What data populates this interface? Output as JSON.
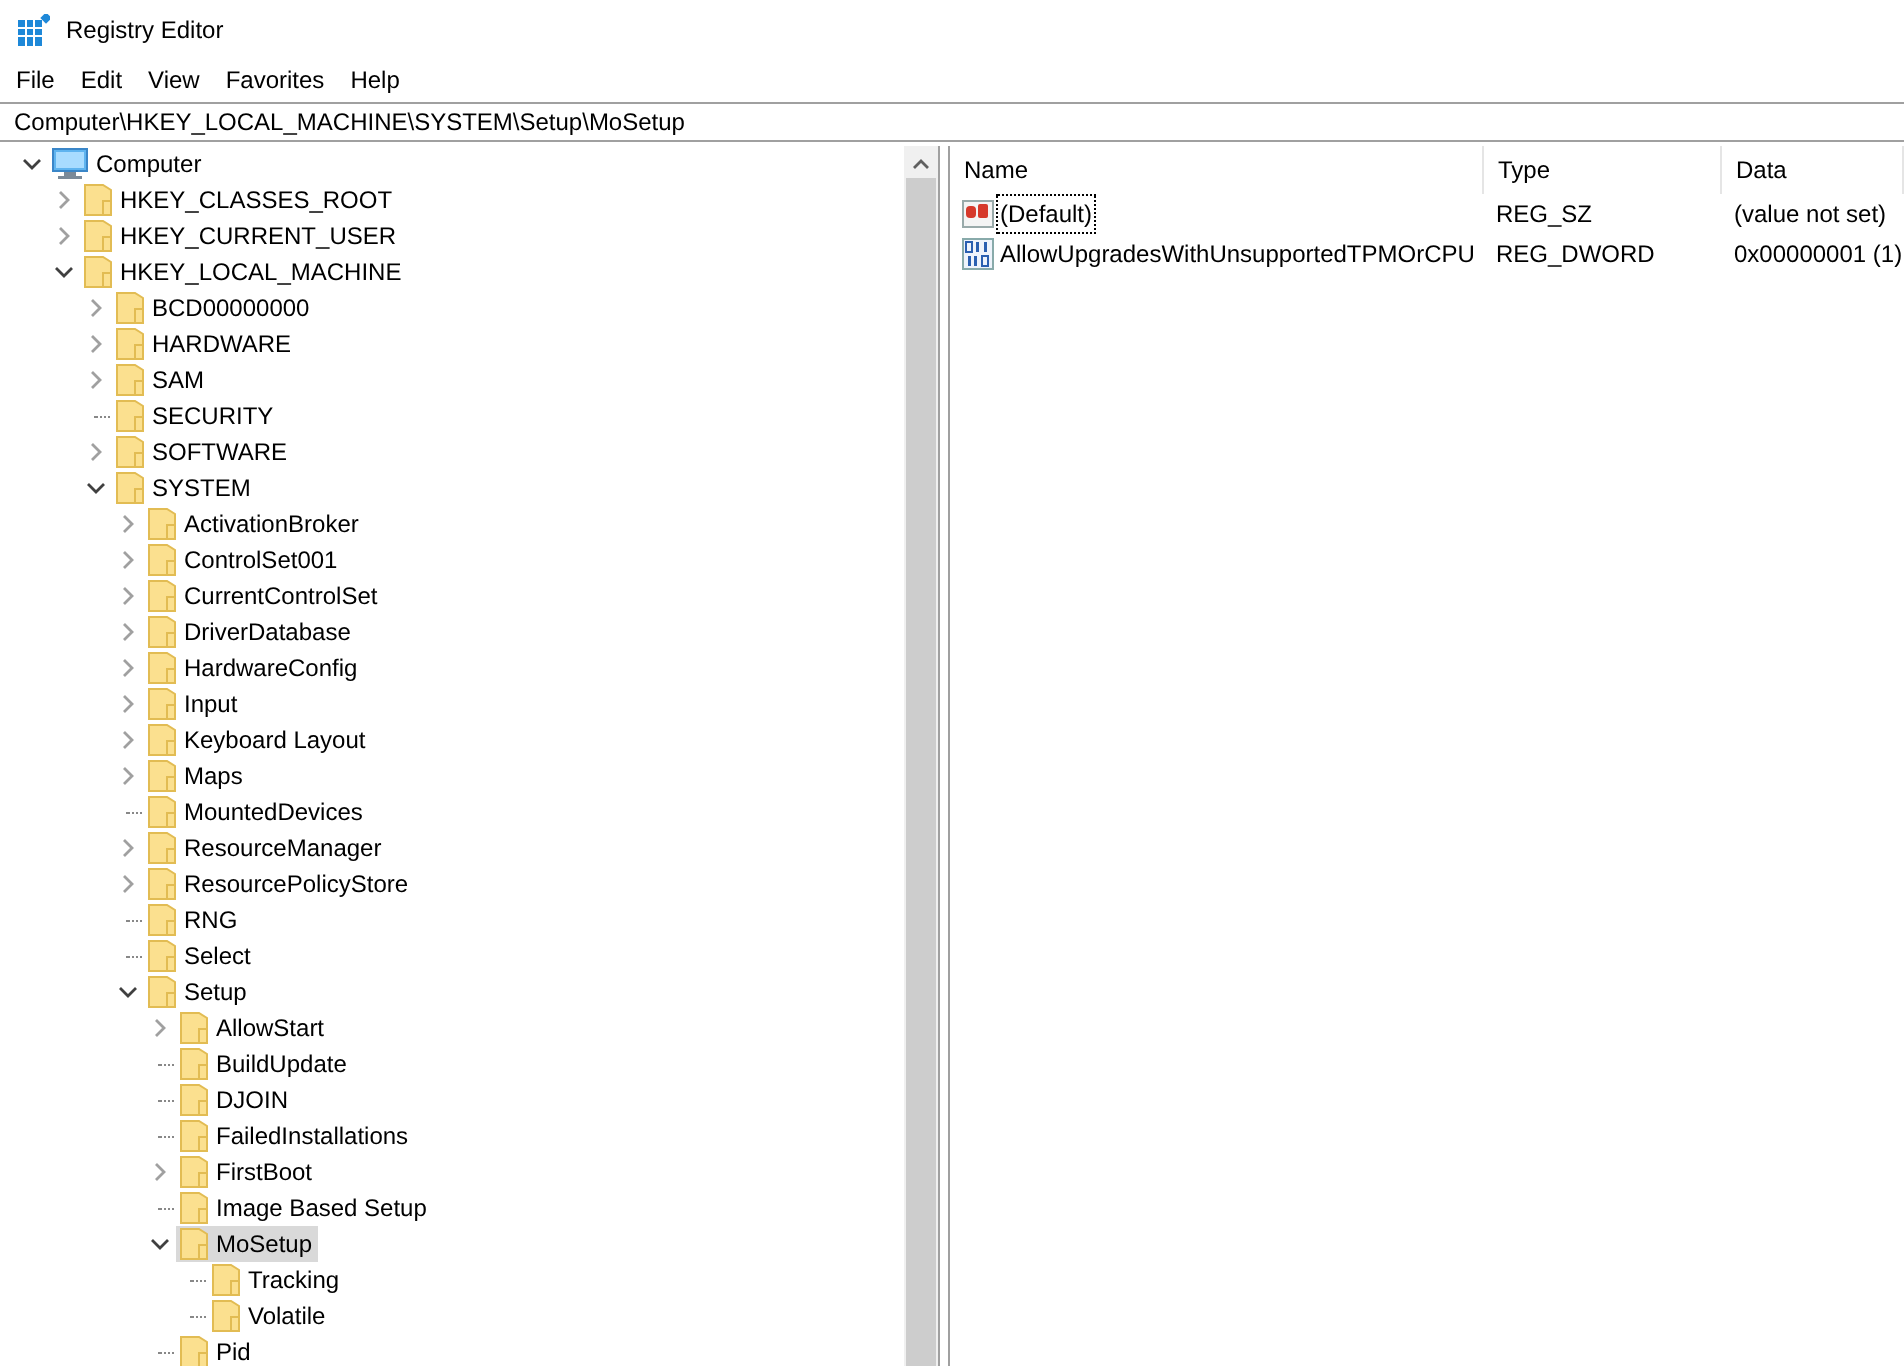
{
  "window": {
    "title": "Registry Editor"
  },
  "menu": [
    "File",
    "Edit",
    "View",
    "Favorites",
    "Help"
  ],
  "address": "Computer\\HKEY_LOCAL_MACHINE\\SYSTEM\\Setup\\MoSetup",
  "tree": [
    {
      "label": "Computer",
      "kind": "computer",
      "has_children": true,
      "expanded": true,
      "selected": false,
      "children": [
        {
          "label": "HKEY_CLASSES_ROOT",
          "kind": "folder",
          "has_children": true,
          "expanded": false,
          "selected": false
        },
        {
          "label": "HKEY_CURRENT_USER",
          "kind": "folder",
          "has_children": true,
          "expanded": false,
          "selected": false
        },
        {
          "label": "HKEY_LOCAL_MACHINE",
          "kind": "folder",
          "has_children": true,
          "expanded": true,
          "selected": false,
          "children": [
            {
              "label": "BCD00000000",
              "kind": "folder",
              "has_children": true,
              "expanded": false,
              "selected": false
            },
            {
              "label": "HARDWARE",
              "kind": "folder",
              "has_children": true,
              "expanded": false,
              "selected": false
            },
            {
              "label": "SAM",
              "kind": "folder",
              "has_children": true,
              "expanded": false,
              "selected": false
            },
            {
              "label": "SECURITY",
              "kind": "folder",
              "has_children": false,
              "expanded": false,
              "selected": false
            },
            {
              "label": "SOFTWARE",
              "kind": "folder",
              "has_children": true,
              "expanded": false,
              "selected": false
            },
            {
              "label": "SYSTEM",
              "kind": "folder",
              "has_children": true,
              "expanded": true,
              "selected": false,
              "children": [
                {
                  "label": "ActivationBroker",
                  "kind": "folder",
                  "has_children": true,
                  "expanded": false,
                  "selected": false
                },
                {
                  "label": "ControlSet001",
                  "kind": "folder",
                  "has_children": true,
                  "expanded": false,
                  "selected": false
                },
                {
                  "label": "CurrentControlSet",
                  "kind": "folder",
                  "has_children": true,
                  "expanded": false,
                  "selected": false
                },
                {
                  "label": "DriverDatabase",
                  "kind": "folder",
                  "has_children": true,
                  "expanded": false,
                  "selected": false
                },
                {
                  "label": "HardwareConfig",
                  "kind": "folder",
                  "has_children": true,
                  "expanded": false,
                  "selected": false
                },
                {
                  "label": "Input",
                  "kind": "folder",
                  "has_children": true,
                  "expanded": false,
                  "selected": false
                },
                {
                  "label": "Keyboard Layout",
                  "kind": "folder",
                  "has_children": true,
                  "expanded": false,
                  "selected": false
                },
                {
                  "label": "Maps",
                  "kind": "folder",
                  "has_children": true,
                  "expanded": false,
                  "selected": false
                },
                {
                  "label": "MountedDevices",
                  "kind": "folder",
                  "has_children": false,
                  "expanded": false,
                  "selected": false
                },
                {
                  "label": "ResourceManager",
                  "kind": "folder",
                  "has_children": true,
                  "expanded": false,
                  "selected": false
                },
                {
                  "label": "ResourcePolicyStore",
                  "kind": "folder",
                  "has_children": true,
                  "expanded": false,
                  "selected": false
                },
                {
                  "label": "RNG",
                  "kind": "folder",
                  "has_children": false,
                  "expanded": false,
                  "selected": false
                },
                {
                  "label": "Select",
                  "kind": "folder",
                  "has_children": false,
                  "expanded": false,
                  "selected": false
                },
                {
                  "label": "Setup",
                  "kind": "folder",
                  "has_children": true,
                  "expanded": true,
                  "selected": false,
                  "children": [
                    {
                      "label": "AllowStart",
                      "kind": "folder",
                      "has_children": true,
                      "expanded": false,
                      "selected": false
                    },
                    {
                      "label": "BuildUpdate",
                      "kind": "folder",
                      "has_children": false,
                      "expanded": false,
                      "selected": false
                    },
                    {
                      "label": "DJOIN",
                      "kind": "folder",
                      "has_children": false,
                      "expanded": false,
                      "selected": false
                    },
                    {
                      "label": "FailedInstallations",
                      "kind": "folder",
                      "has_children": false,
                      "expanded": false,
                      "selected": false
                    },
                    {
                      "label": "FirstBoot",
                      "kind": "folder",
                      "has_children": true,
                      "expanded": false,
                      "selected": false
                    },
                    {
                      "label": "Image Based Setup",
                      "kind": "folder",
                      "has_children": false,
                      "expanded": false,
                      "selected": false
                    },
                    {
                      "label": "MoSetup",
                      "kind": "folder",
                      "has_children": true,
                      "expanded": true,
                      "selected": true,
                      "children": [
                        {
                          "label": "Tracking",
                          "kind": "folder",
                          "has_children": false,
                          "expanded": false,
                          "selected": false
                        },
                        {
                          "label": "Volatile",
                          "kind": "folder",
                          "has_children": false,
                          "expanded": false,
                          "selected": false
                        }
                      ]
                    },
                    {
                      "label": "Pid",
                      "kind": "folder",
                      "has_children": false,
                      "expanded": false,
                      "selected": false
                    }
                  ]
                }
              ]
            }
          ]
        }
      ]
    }
  ],
  "values": {
    "columns": [
      "Name",
      "Type",
      "Data"
    ],
    "rows": [
      {
        "name": "(Default)",
        "kind": "string",
        "type": "REG_SZ",
        "data": "(value not set)",
        "focused": true
      },
      {
        "name": "AllowUpgradesWithUnsupportedTPMOrCPU",
        "kind": "binary",
        "type": "REG_DWORD",
        "data": "0x00000001 (1)",
        "focused": false
      }
    ]
  }
}
